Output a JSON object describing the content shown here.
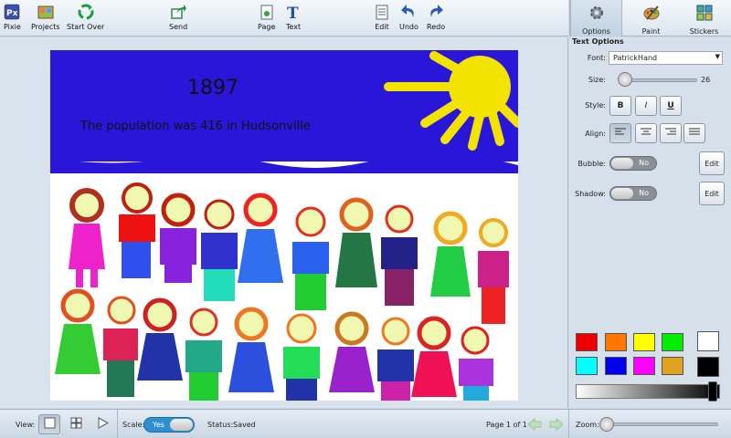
{
  "toolbar": {
    "pixie": "Pixie",
    "projects": "Projects",
    "start_over": "Start Over",
    "send": "Send",
    "page": "Page",
    "text": "Text",
    "edit": "Edit",
    "undo": "Undo",
    "redo": "Redo"
  },
  "tabs": {
    "options": "Options",
    "paint": "Paint",
    "stickers": "Stickers",
    "active": "Options"
  },
  "canvas": {
    "year": "1897",
    "caption": "The population was 416 in Hudsonville",
    "sky_color": "#2a16d8",
    "sun_color": "#f3e400"
  },
  "panel": {
    "title": "Text Options",
    "font_label": "Font:",
    "font_value": "PatrickHand",
    "size_label": "Size:",
    "size_value": "26",
    "style_label": "Style:",
    "bold": "B",
    "italic": "I",
    "underline": "U",
    "align_label": "Align:",
    "align_selected": "left",
    "bubble_label": "Bubble:",
    "bubble_value": "No",
    "shadow_label": "Shadow:",
    "shadow_value": "No",
    "edit_label": "Edit",
    "colors": [
      "#ee0000",
      "#ff7700",
      "#ffff00",
      "#00ee00",
      "#ffffff",
      "#00ffff",
      "#0000ee",
      "#ff00ff",
      "#e0a020",
      "#000000"
    ]
  },
  "bottom": {
    "view_label": "View:",
    "scale_label": "Scale:",
    "scale_value": "Yes",
    "status_label": "Status:",
    "status_value": "Saved",
    "page_indicator": "Page 1 of 1",
    "zoom_label": "Zoom:"
  }
}
